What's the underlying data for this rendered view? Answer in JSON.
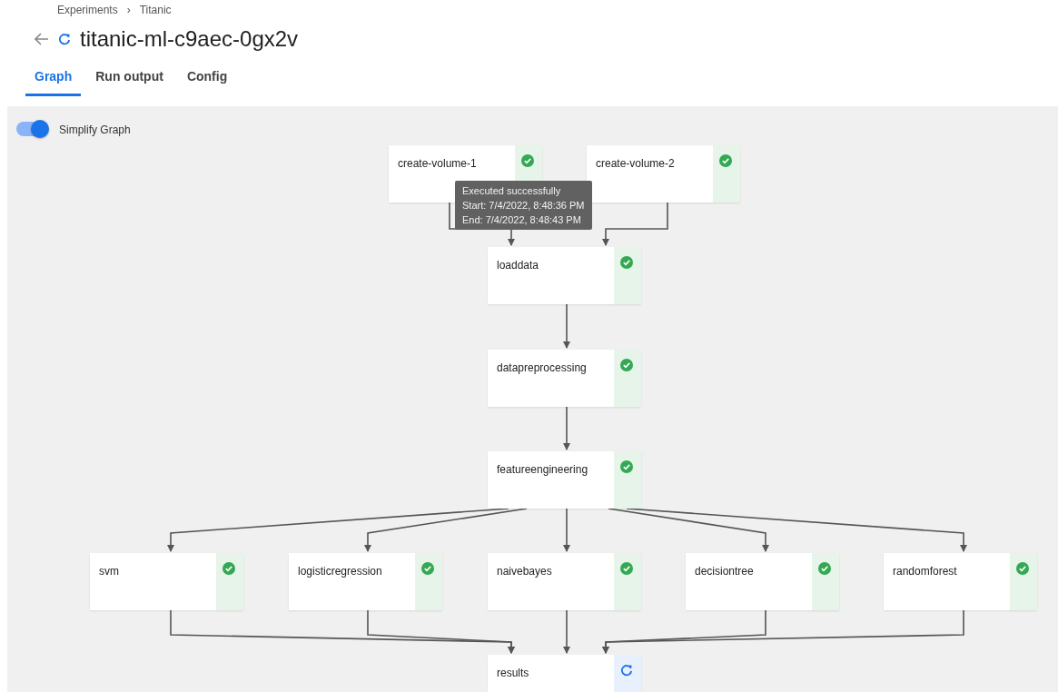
{
  "breadcrumb": {
    "items": [
      "Experiments",
      "Titanic"
    ],
    "separator": "›"
  },
  "title": "titanic-ml-c9aec-0gx2v",
  "run_icon": {
    "kind": "running"
  },
  "tabs": [
    {
      "label": "Graph",
      "selected": true
    },
    {
      "label": "Run output",
      "selected": false
    },
    {
      "label": "Config",
      "selected": false
    }
  ],
  "simplify_toggle": {
    "label": "Simplify Graph",
    "on": true
  },
  "nodes": [
    {
      "label": "create-volume-1",
      "kind": "succeeded"
    },
    {
      "label": "create-volume-2",
      "kind": "succeeded"
    },
    {
      "label": "loaddata",
      "kind": "succeeded"
    },
    {
      "label": "datapreprocessing",
      "kind": "succeeded"
    },
    {
      "label": "featureengineering",
      "kind": "succeeded"
    },
    {
      "label": "svm",
      "kind": "succeeded"
    },
    {
      "label": "logisticregression",
      "kind": "succeeded"
    },
    {
      "label": "naivebayes",
      "kind": "succeeded"
    },
    {
      "label": "decisiontree",
      "kind": "succeeded"
    },
    {
      "label": "randomforest",
      "kind": "succeeded"
    },
    {
      "label": "results",
      "kind": "running"
    }
  ],
  "tooltip": {
    "lines": [
      "Executed successfully",
      "Start: 7/4/2022, 8:48:36 PM",
      "End: 7/4/2022, 8:48:43 PM"
    ]
  }
}
